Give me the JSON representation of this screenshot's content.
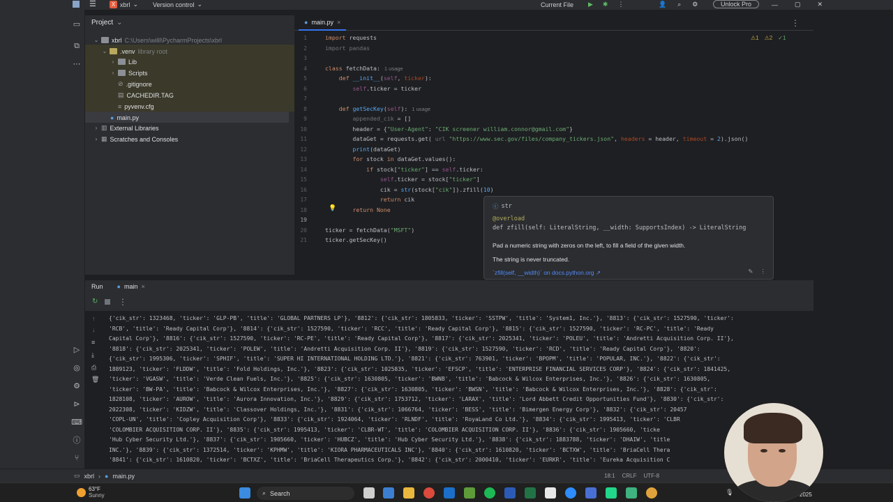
{
  "titlebar": {
    "project_badge": "X",
    "project_name": "xbrl",
    "vcs": "Version control",
    "run_config": "Current File",
    "unlock": "Unlock Pro"
  },
  "project_panel": {
    "title": "Project",
    "tree": [
      {
        "label": "xbrl",
        "note": "C:\\Users\\willl\\PycharmProjects\\xbrl"
      },
      {
        "label": ".venv",
        "note": "library root"
      },
      {
        "label": "Lib",
        "note": ""
      },
      {
        "label": "Scripts",
        "note": ""
      },
      {
        "label": ".gitignore",
        "note": ""
      },
      {
        "label": "CACHEDIR.TAG",
        "note": ""
      },
      {
        "label": "pyvenv.cfg",
        "note": ""
      },
      {
        "label": "main.py",
        "note": ""
      },
      {
        "label": "External Libraries",
        "note": ""
      },
      {
        "label": "Scratches and Consoles",
        "note": ""
      }
    ]
  },
  "editor": {
    "tab": "main.py",
    "inspections": {
      "warnings": "1",
      "weak": "2",
      "typos": "1"
    },
    "line_numbers": [
      "1",
      "2",
      "3",
      "4",
      "5",
      "6",
      "7",
      "8",
      "9",
      "10",
      "11",
      "12",
      "13",
      "14",
      "15",
      "16",
      "17",
      "18",
      "19",
      "20",
      "21"
    ],
    "usage_hint": "1 usage"
  },
  "popup": {
    "type": "str",
    "decorator": "@overload",
    "signature": "def zfill(self: LiteralString, __width: SupportsIndex) -> LiteralString",
    "description": "Pad a numeric string with zeros on the left, to fill a field of the given width.",
    "note": "The string is never truncated.",
    "link": "`zfill(self, __width)` on docs.python.org ↗"
  },
  "run_panel": {
    "title": "Run",
    "tab": "main",
    "lines": [
      "{'cik_str': 1323468, 'ticker': 'GLP-PB', 'title': 'GLOBAL PARTNERS LP'}, '8812': {'cik_str': 1805833, 'ticker': 'SSTPW', 'title': 'System1, Inc.'}, '8813': {'cik_str': 1527590, 'ticker':",
      "'RCB', 'title': 'Ready Capital Corp'}, '8814': {'cik_str': 1527590, 'ticker': 'RCC', 'title': 'Ready Capital Corp'}, '8815': {'cik_str': 1527590, 'ticker': 'RC-PC', 'title': 'Ready",
      "Capital Corp'}, '8816': {'cik_str': 1527590, 'ticker': 'RC-PE', 'title': 'Ready Capital Corp'}, '8817': {'cik_str': 2025341, 'ticker': 'POLEU', 'title': 'Andretti Acquisition Corp. II'},",
      "'8818': {'cik_str': 2025341, 'ticker': 'POLEW', 'title': 'Andretti Acquisition Corp. II'}, '8819': {'cik_str': 1527590, 'ticker': 'RCD', 'title': 'Ready Capital Corp'}, '8820':",
      "{'cik_str': 1995306, 'ticker': 'SPHIF', 'title': 'SUPER HI INTERNATIONAL HOLDING LTD.'}, '8821': {'cik_str': 763901, 'ticker': 'BPOPM', 'title': 'POPULAR, INC.'}, '8822': {'cik_str':",
      "1889123, 'ticker': 'FLDDW', 'title': 'Fold Holdings, Inc.'}, '8823': {'cik_str': 1025835, 'ticker': 'EFSCP', 'title': 'ENTERPRISE FINANCIAL SERVICES CORP'}, '8824': {'cik_str': 1841425,",
      "'ticker': 'VGASW', 'title': 'Verde Clean Fuels, Inc.'}, '8825': {'cik_str': 1630805, 'ticker': 'BWNB', 'title': 'Babcock & Wilcox Enterprises, Inc.'}, '8826': {'cik_str': 1630805,",
      "'ticker': 'BW-PA', 'title': 'Babcock & Wilcox Enterprises, Inc.'}, '8827': {'cik_str': 1630805, 'ticker': 'BWSN', 'title': 'Babcock & Wilcox Enterprises, Inc.'}, '8828': {'cik_str':",
      "1828108, 'ticker': 'AUROW', 'title': 'Aurora Innovation, Inc.'}, '8829': {'cik_str': 1753712, 'ticker': 'LARAX', 'title': 'Lord Abbett Credit Opportunities Fund'}, '8830': {'cik_str':",
      "2022308, 'ticker': 'KIDZW', 'title': 'Classover Holdings, Inc.'}, '8831': {'cik_str': 1066764, 'ticker': 'BESS', 'title': 'Bimergen Energy Corp'}, '8832': {'cik_str': 20457",
      "'COPL-UN', 'title': 'Copley Acquisition Corp'}, '8833': {'cik_str': 1924064, 'ticker': 'RLNDF', 'title': 'RoyaLand Co Ltd.'}, '8834': {'cik_str': 1995413, 'ticker': 'CLBR",
      "'COLOMBIER ACQUISITION CORP. II'}, '8835': {'cik_str': 1995413, 'ticker': 'CLBR-WT', 'title': 'COLOMBIER ACQUISITION CORP. II'}, '8836': {'cik_str': 1905660, 'ticke",
      "'Hub Cyber Security Ltd.'}, '8837': {'cik_str': 1905660, 'ticker': 'HUBCZ', 'title': 'Hub Cyber Security Ltd.'}, '8838': {'cik_str': 1883788, 'ticker': 'DHAIW', 'title",
      "INC.'}, '8839': {'cik_str': 1372514, 'ticker': 'KPHMW', 'title': 'KIORA PHARMACEUTICALS INC'}, '8840': {'cik_str': 1610820, 'ticker': 'BCTXW', 'title': 'BriaCell Thera",
      "'8841': {'cik_str': 1610820, 'ticker': 'BCTXZ', 'title': 'BriaCell Therapeutics Corp.'}, '8842': {'cik_str': 2000410, 'ticker': 'EURKR', 'title': 'Eureka Acquisition C"
    ]
  },
  "statusbar": {
    "crumb_project": "xbrl",
    "crumb_file": "main.py",
    "position": "18:1",
    "line_sep": "CRLF",
    "encoding": "UTF-8"
  },
  "taskbar": {
    "temp": "63°F",
    "condition": "Sunny",
    "search": "Search",
    "year": "2025"
  }
}
